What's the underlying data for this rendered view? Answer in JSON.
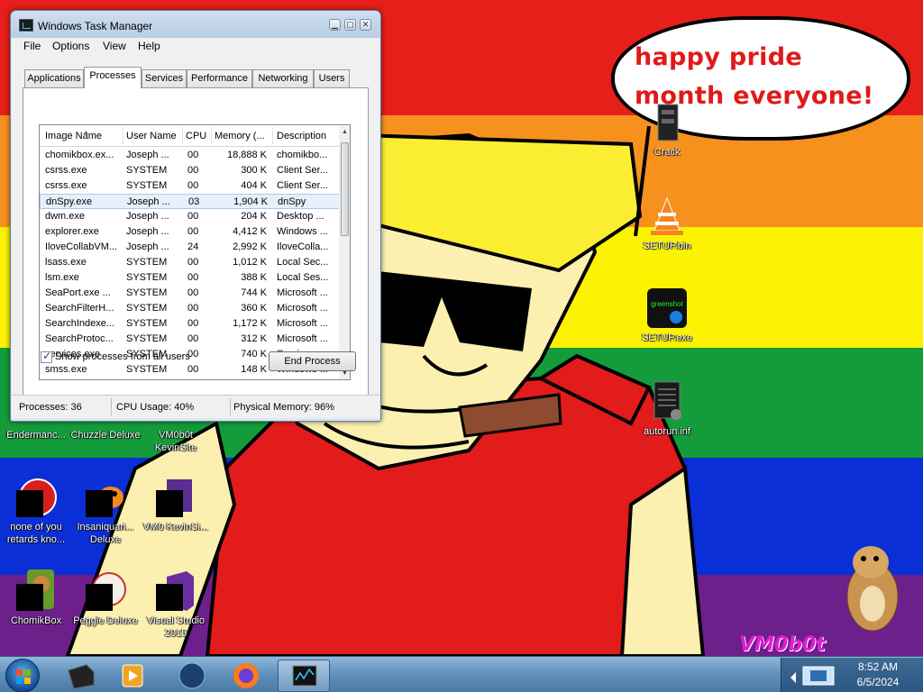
{
  "desktop": {
    "speech_bubble": "happy pride month everyone!",
    "signature": "VM0b0t",
    "icons": [
      {
        "label": "Crack",
        "icon": "archive-icon"
      },
      {
        "label": "SETUP.bin",
        "icon": "vlc-cone-icon"
      },
      {
        "label": "SETUP.exe",
        "icon": "green-app-icon"
      },
      {
        "label": "autorun.inf",
        "icon": "text-file-icon"
      },
      {
        "label": "Endermanc...",
        "icon": "app-icon"
      },
      {
        "label": "Chuzzle Deluxe",
        "icon": "game-icon"
      },
      {
        "label": "VM0b0t KevinSite",
        "icon": "app-icon"
      },
      {
        "label": "none of you retards kno...",
        "icon": "red-circle-icon"
      },
      {
        "label": "Insaniquari... Deluxe",
        "icon": "fish-icon"
      },
      {
        "label": "VM0 KevinSi...",
        "icon": "purple-app-icon"
      },
      {
        "label": "ChomikBox",
        "icon": "hamster-box-icon"
      },
      {
        "label": "Peggle Deluxe",
        "icon": "peggle-icon"
      },
      {
        "label": "Visual Studio 2015",
        "icon": "visual-studio-icon"
      }
    ]
  },
  "task_manager": {
    "title": "Windows Task Manager",
    "menu": [
      "File",
      "Options",
      "View",
      "Help"
    ],
    "tabs": [
      "Applications",
      "Processes",
      "Services",
      "Performance",
      "Networking",
      "Users"
    ],
    "active_tab": "Processes",
    "columns": [
      "Image Name",
      "User Name",
      "CPU",
      "Memory (...",
      "Description"
    ],
    "rows": [
      {
        "name": "chomikbox.ex...",
        "user": "Joseph ...",
        "cpu": "00",
        "mem": "18,888 K",
        "desc": "chomikbo..."
      },
      {
        "name": "csrss.exe",
        "user": "SYSTEM",
        "cpu": "00",
        "mem": "300 K",
        "desc": "Client Ser..."
      },
      {
        "name": "csrss.exe",
        "user": "SYSTEM",
        "cpu": "00",
        "mem": "404 K",
        "desc": "Client Ser..."
      },
      {
        "name": "dnSpy.exe",
        "user": "Joseph ...",
        "cpu": "03",
        "mem": "1,904 K",
        "desc": "dnSpy"
      },
      {
        "name": "dwm.exe",
        "user": "Joseph ...",
        "cpu": "00",
        "mem": "204 K",
        "desc": "Desktop ..."
      },
      {
        "name": "explorer.exe",
        "user": "Joseph ...",
        "cpu": "00",
        "mem": "4,412 K",
        "desc": "Windows ..."
      },
      {
        "name": "IloveCollabVM...",
        "user": "Joseph ...",
        "cpu": "24",
        "mem": "2,992 K",
        "desc": "IloveColla..."
      },
      {
        "name": "lsass.exe",
        "user": "SYSTEM",
        "cpu": "00",
        "mem": "1,012 K",
        "desc": "Local Sec..."
      },
      {
        "name": "lsm.exe",
        "user": "SYSTEM",
        "cpu": "00",
        "mem": "388 K",
        "desc": "Local Ses..."
      },
      {
        "name": "SeaPort.exe ...",
        "user": "SYSTEM",
        "cpu": "00",
        "mem": "744 K",
        "desc": "Microsoft ..."
      },
      {
        "name": "SearchFilterH...",
        "user": "SYSTEM",
        "cpu": "00",
        "mem": "360 K",
        "desc": "Microsoft ..."
      },
      {
        "name": "SearchIndexe...",
        "user": "SYSTEM",
        "cpu": "00",
        "mem": "1,172 K",
        "desc": "Microsoft ..."
      },
      {
        "name": "SearchProtoc...",
        "user": "SYSTEM",
        "cpu": "00",
        "mem": "312 K",
        "desc": "Microsoft ..."
      },
      {
        "name": "services.exe",
        "user": "SYSTEM",
        "cpu": "00",
        "mem": "740 K",
        "desc": "Services ..."
      },
      {
        "name": "smss.exe",
        "user": "SYSTEM",
        "cpu": "00",
        "mem": "148 K",
        "desc": "Windows ..."
      }
    ],
    "selected_row": "dnSpy.exe",
    "show_all_label": "Show processes from all users",
    "show_all_checked": true,
    "end_process_label": "End Process",
    "status": {
      "processes": "Processes: 36",
      "cpu": "CPU Usage: 40%",
      "memory": "Physical Memory: 96%"
    }
  },
  "taskbar": {
    "pinned": [
      "explorer-icon",
      "media-player-icon",
      "app-icon",
      "firefox-icon",
      "task-manager-icon"
    ],
    "active": "task-manager-icon",
    "clock_time": "8:52 AM",
    "clock_date": "6/5/2024"
  },
  "colors": {
    "red": "#e61f1a",
    "orange": "#f6911e",
    "yellow": "#fbf301",
    "green": "#149c3a",
    "blue": "#0b2fd6",
    "purple": "#6d1f8c",
    "bubble_text": "#e01a1a"
  }
}
